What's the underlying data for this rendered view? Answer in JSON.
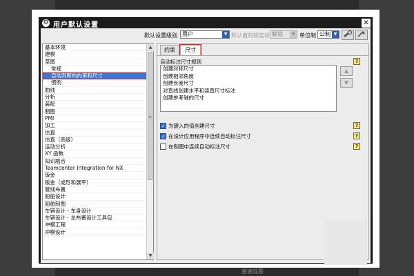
{
  "background": {
    "hint": "感谢观看"
  },
  "window": {
    "title": "用户默认设置",
    "close_glyph": "✕"
  },
  "toolbar": {
    "level_label": "默认设置级别",
    "level_value": "用户",
    "lock_label": "默认值的锁定状态",
    "lock_value": "解锁",
    "unit_label": "单位制",
    "unit_value": "公制",
    "dropdown_glyph": "▼",
    "icons": [
      "settings-tool-icon",
      "manager-tool-icon"
    ]
  },
  "tree": {
    "items": [
      {
        "label": "基本环境",
        "child": false
      },
      {
        "label": "建模",
        "child": false
      },
      {
        "label": "草图",
        "child": false
      },
      {
        "label": "常规",
        "child": true
      },
      {
        "label": "自动判断的约束和尺寸",
        "child": true,
        "selected": true
      },
      {
        "label": "惯例",
        "child": true
      },
      {
        "label": "曲线",
        "child": false
      },
      {
        "label": "分析",
        "child": false
      },
      {
        "label": "装配",
        "child": false
      },
      {
        "label": "制图",
        "child": false
      },
      {
        "label": "PMI",
        "child": false
      },
      {
        "label": "加工",
        "child": false
      },
      {
        "label": "仿真",
        "child": false
      },
      {
        "label": "仿真（高级）",
        "child": false
      },
      {
        "label": "运动分析",
        "child": false
      },
      {
        "label": "XY 函数",
        "child": false
      },
      {
        "label": "知识融合",
        "child": false
      },
      {
        "label": "Teamcenter Integration for NX",
        "child": false
      },
      {
        "label": "钣金",
        "child": false
      },
      {
        "label": "钣金（成形和展平）",
        "child": false
      },
      {
        "label": "管线布置",
        "child": false
      },
      {
        "label": "船舶设计",
        "child": false
      },
      {
        "label": "船舶制图",
        "child": false
      },
      {
        "label": "车辆设计 - 车身设计",
        "child": false
      },
      {
        "label": "车辆设计 - 总布置设计工具包",
        "child": false
      },
      {
        "label": "冲模工程",
        "child": false
      },
      {
        "label": "冲模设计",
        "child": false
      }
    ],
    "scroll_up": "▲",
    "scroll_down": "▼",
    "thumb_grip": "≡"
  },
  "tabs": [
    {
      "label": "约束",
      "active": false
    },
    {
      "label": "尺寸",
      "active": true
    }
  ],
  "dimensions_tab": {
    "section_label": "自动标注尺寸规则",
    "rules": [
      "创建对称尺寸",
      "创建相邻角度",
      "创建长度尺寸",
      "对直线创建水平和竖直尺寸标注",
      "创建参考轴的尺寸"
    ],
    "move_up_glyph": "▲",
    "move_down_glyph": "▼",
    "help_glyph": "?",
    "options": [
      {
        "label": "为键入的值创建尺寸",
        "checked": true
      },
      {
        "label": "在设计应用程序中连续自动标注尺寸",
        "checked": true
      },
      {
        "label": "在制图中连续自动标注尺寸",
        "checked": false
      }
    ],
    "check_glyph": "✓"
  },
  "colors": {
    "selection": "#3a78d8",
    "highlight_box": "#e02020",
    "title_bar": "#1c1c1c",
    "help_icon": "#f7e66a"
  }
}
